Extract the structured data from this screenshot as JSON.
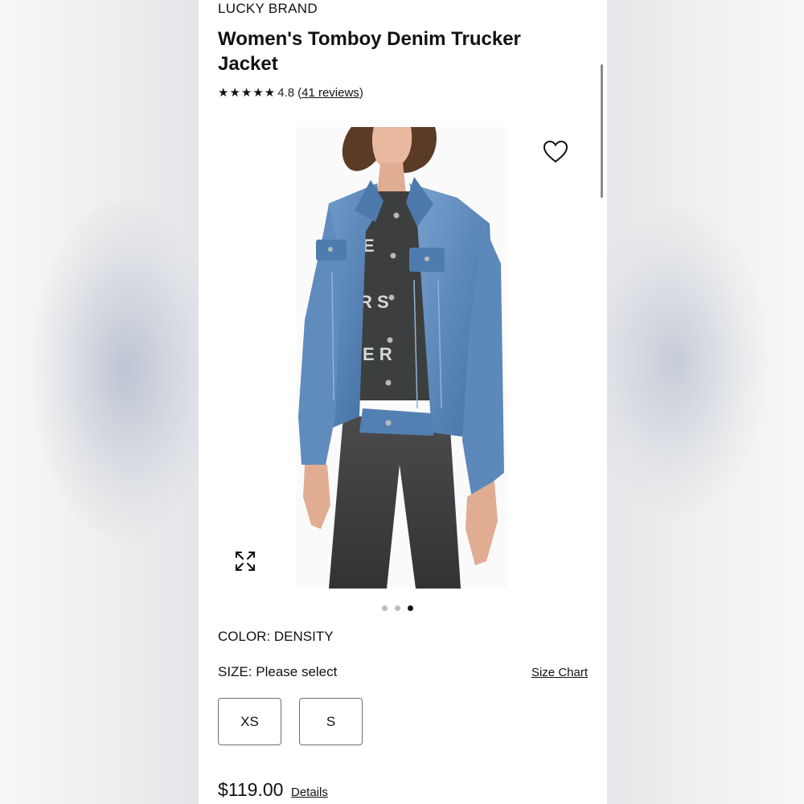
{
  "product": {
    "brand": "LUCKY BRAND",
    "title": "Women's Tomboy Denim Trucker Jacket",
    "stars": "★★★★★",
    "rating": "4.8",
    "reviews_open": "(",
    "reviews_label": "41 reviews",
    "reviews_close": ")"
  },
  "gallery": {
    "image_icon": "product-photo",
    "wishlist_icon": "heart-icon",
    "expand_icon": "expand-icon",
    "dots_total": 3,
    "dots_active": 3
  },
  "color": {
    "label": "COLOR: DENSITY"
  },
  "size": {
    "label": "SIZE:",
    "value": "Please select",
    "chart_link": "Size Chart",
    "options": [
      "XS",
      "S"
    ]
  },
  "price": {
    "amount": "$119.00",
    "details_link": "Details"
  },
  "colors": {
    "denim": "#5a86b8",
    "jeans": "#3d3d3f",
    "accent": "#111111"
  }
}
